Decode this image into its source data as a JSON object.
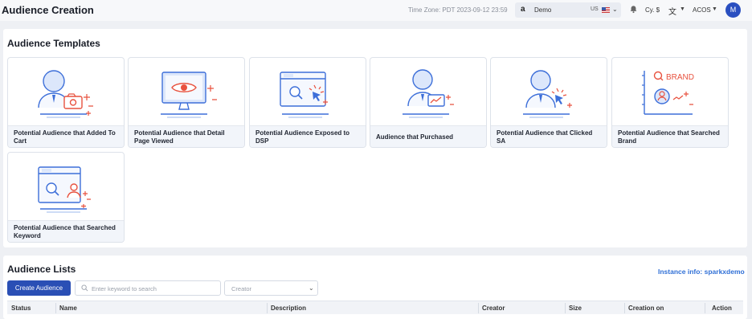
{
  "header": {
    "title": "Audience Creation",
    "timezone": "Time Zone: PDT 2023-09-12 23:59",
    "store": {
      "logo": "a",
      "name": "Demo",
      "country": "US"
    },
    "currency": "Cy. $",
    "metric": "ACOS",
    "avatar_initial": "M",
    "icons": [
      "amazon-logo-icon",
      "us-flag-icon",
      "bell-icon",
      "translate-icon",
      "chevron-down-icon"
    ]
  },
  "templates": {
    "title": "Audience Templates",
    "cards": [
      {
        "label": "Potential Audience that Added To Cart",
        "icon": "person-camera-icon"
      },
      {
        "label": "Potential Audience that Detail Page Viewed",
        "icon": "monitor-eye-icon"
      },
      {
        "label": "Potential Audience Exposed to DSP",
        "icon": "browser-search-click-icon"
      },
      {
        "label": "Audience that Purchased",
        "icon": "person-laptop-icon"
      },
      {
        "label": "Potential Audience that Clicked SA",
        "icon": "person-click-icon"
      },
      {
        "label": "Potential Audience that Searched Brand",
        "icon": "brand-search-chart-icon",
        "illustration_text": "BRAND"
      },
      {
        "label": "Potential Audience that Searched Keyword",
        "icon": "browser-search-person-icon"
      }
    ]
  },
  "lists": {
    "title": "Audience Lists",
    "instance_info": "Instance info: sparkxdemo",
    "create_button": "Create Audience",
    "search_placeholder": "Enter keyword to search",
    "creator_placeholder": "Creator",
    "columns": [
      "Status",
      "Name",
      "Description",
      "Creator",
      "Size",
      "Creation on",
      "Action"
    ]
  },
  "colors": {
    "accent_blue": "#2a4fb5",
    "link_blue": "#2f6fd6",
    "illus_blue": "#3d6fd9",
    "illus_red": "#e8523f"
  }
}
